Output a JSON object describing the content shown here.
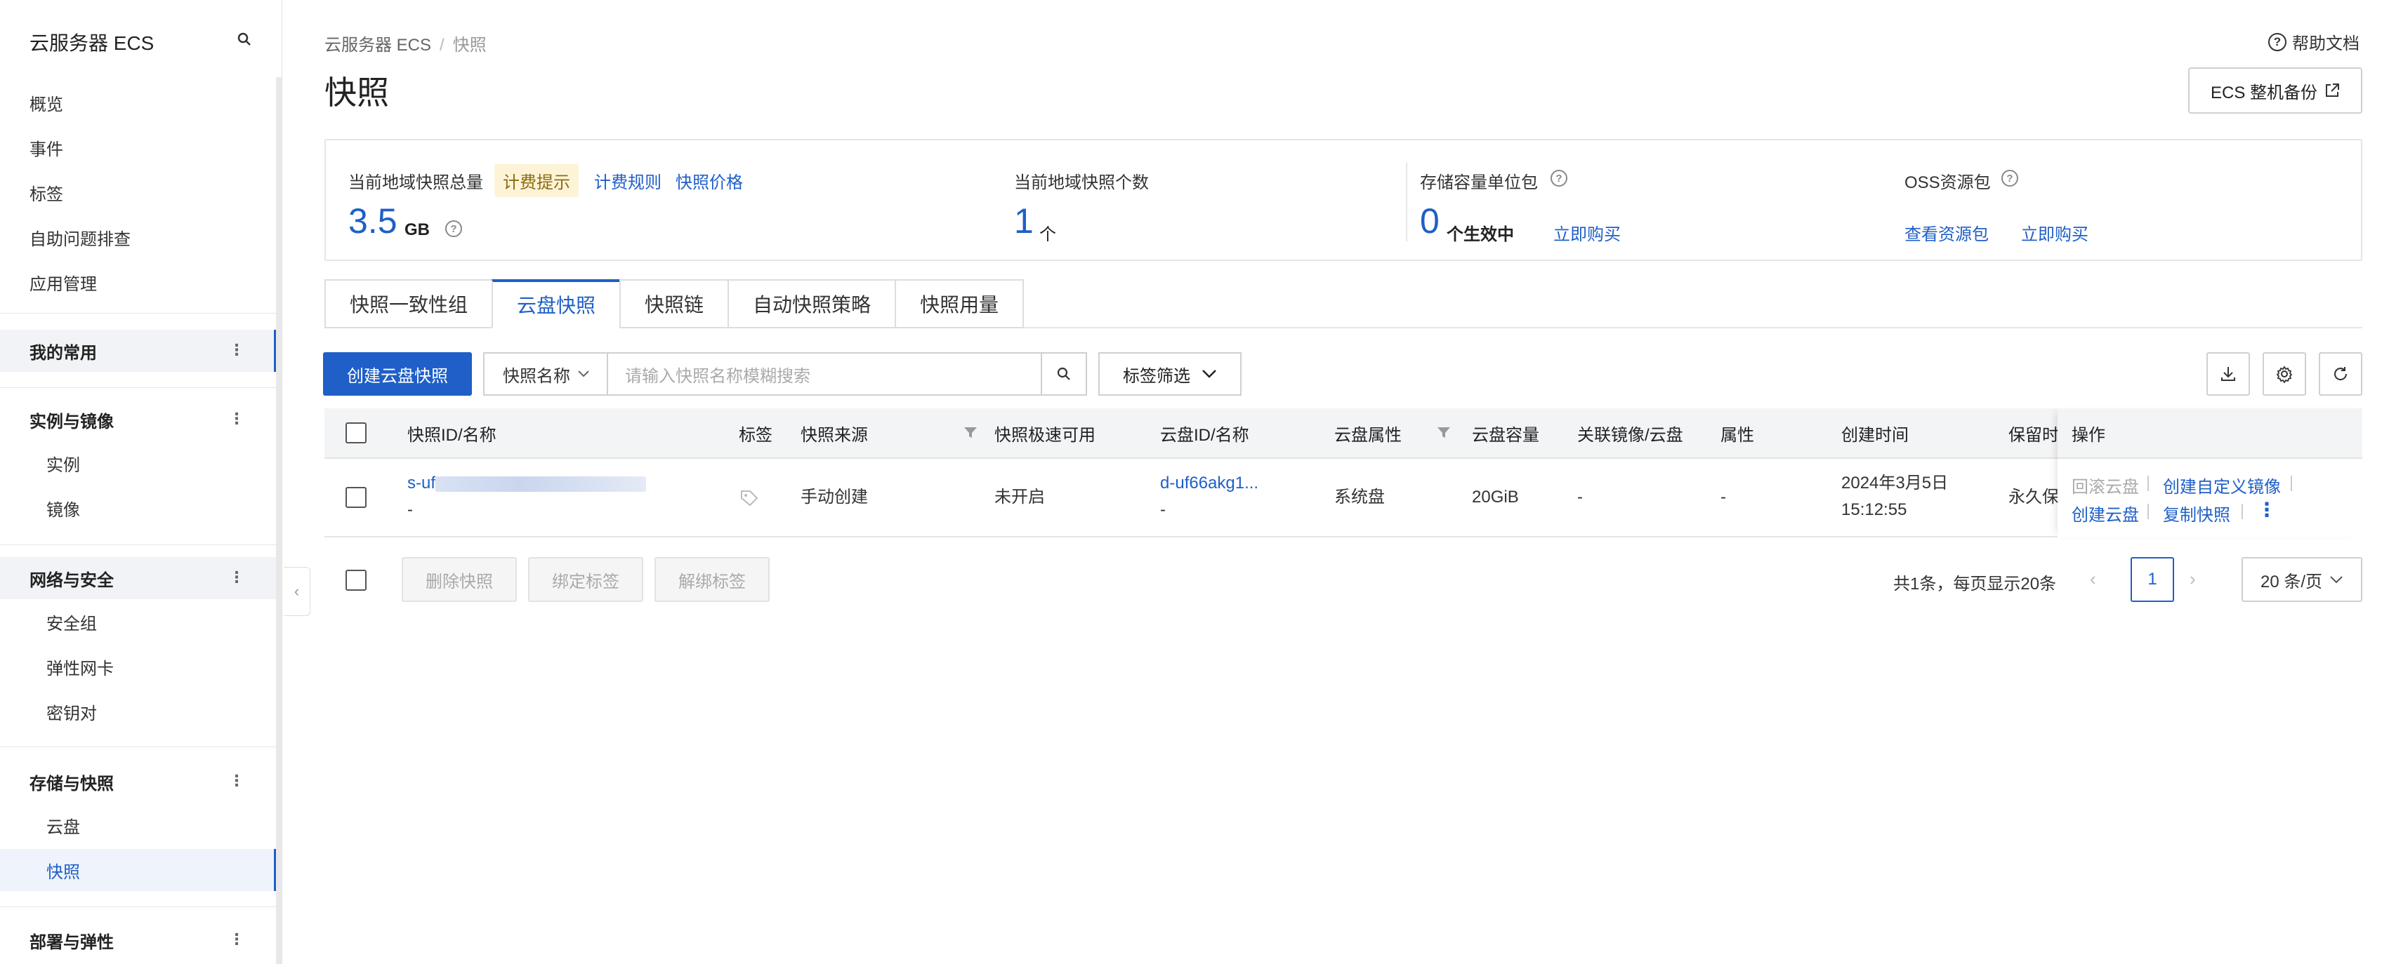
{
  "sidebar": {
    "title": "云服务器 ECS",
    "items": [
      {
        "label": "概览"
      },
      {
        "label": "事件"
      },
      {
        "label": "标签"
      },
      {
        "label": "自助问题排查"
      },
      {
        "label": "应用管理"
      }
    ],
    "groups": {
      "favorites": "我的常用",
      "instances": "实例与镜像",
      "instances_items": [
        "实例",
        "镜像"
      ],
      "network": "网络与安全",
      "network_items": [
        "安全组",
        "弹性网卡",
        "密钥对"
      ],
      "storage": "存储与快照",
      "storage_items": [
        "云盘",
        "快照"
      ],
      "deploy": "部署与弹性"
    }
  },
  "header": {
    "breadcrumb": [
      "云服务器 ECS",
      "快照"
    ],
    "help": "帮助文档",
    "title": "快照",
    "backup_button": "ECS 整机备份"
  },
  "stats": {
    "total_label": "当前地域快照总量",
    "billing_tip": "计费提示",
    "billing_rules": "计费规则",
    "snapshot_price": "快照价格",
    "total_value": "3.5",
    "total_unit": "GB",
    "count_label": "当前地域快照个数",
    "count_value": "1",
    "count_unit": "个",
    "package_label": "存储容量单位包",
    "package_value": "0",
    "package_unit": "个生效中",
    "package_buy": "立即购买",
    "oss_label": "OSS资源包",
    "oss_view": "查看资源包",
    "oss_buy": "立即购买"
  },
  "tabs": [
    "快照一致性组",
    "云盘快照",
    "快照链",
    "自动快照策略",
    "快照用量"
  ],
  "toolbar": {
    "create": "创建云盘快照",
    "select_value": "快照名称",
    "search_placeholder": "请输入快照名称模糊搜索",
    "tag_filter": "标签筛选"
  },
  "table": {
    "columns": [
      "快照ID/名称",
      "标签",
      "快照来源",
      "快照极速可用",
      "云盘ID/名称",
      "云盘属性",
      "云盘容量",
      "关联镜像/云盘",
      "属性",
      "创建时间",
      "保留时",
      "操作"
    ],
    "rows": [
      {
        "id": "s-uf",
        "name": "-",
        "source": "手动创建",
        "instant": "未开启",
        "disk_id": "d-uf66akg1...",
        "disk_name": "-",
        "disk_attr": "系统盘",
        "capacity": "20GiB",
        "linked": "-",
        "attr": "-",
        "created_date": "2024年3月5日",
        "created_time": "15:12:55",
        "retention": "永久保",
        "ops": {
          "rollback": "回滚云盘",
          "custom_image": "创建自定义镜像",
          "create_disk": "创建云盘",
          "copy": "复制快照"
        }
      }
    ]
  },
  "footer": {
    "delete": "删除快照",
    "bind_tag": "绑定标签",
    "unbind_tag": "解绑标签",
    "summary": "共1条，每页显示20条",
    "page": "1",
    "page_size": "20 条/页"
  }
}
